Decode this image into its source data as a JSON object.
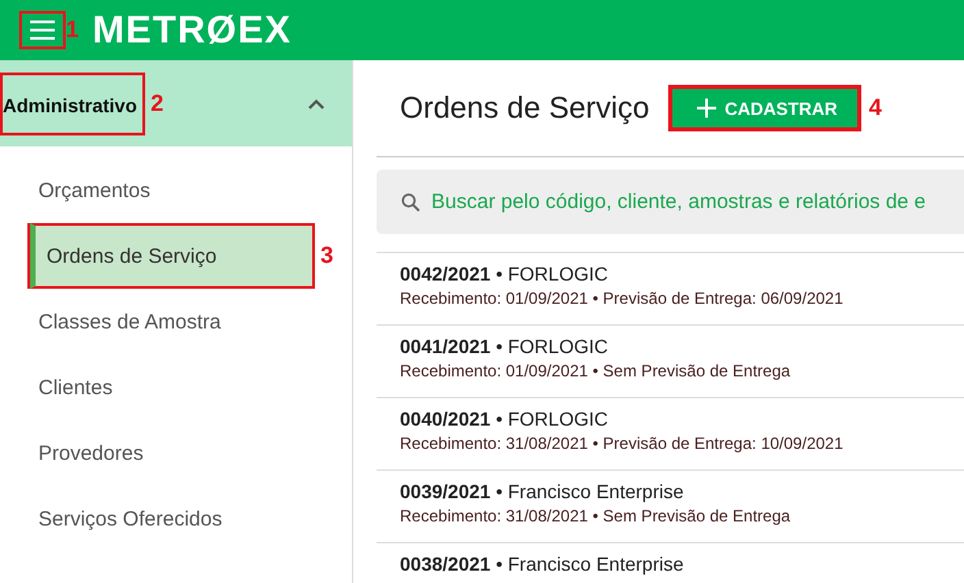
{
  "header": {
    "logo": "METRØEX",
    "menu_callout": "1"
  },
  "sidebar": {
    "section": {
      "label": "Administrativo",
      "expanded": true,
      "callout": "2"
    },
    "items": [
      {
        "label": "Orçamentos",
        "selected": false
      },
      {
        "label": "Ordens de Serviço",
        "selected": true,
        "callout": "3"
      },
      {
        "label": "Classes de Amostra",
        "selected": false
      },
      {
        "label": "Clientes",
        "selected": false
      },
      {
        "label": "Provedores",
        "selected": false
      },
      {
        "label": "Serviços Oferecidos",
        "selected": false
      }
    ]
  },
  "main": {
    "title": "Ordens de Serviço",
    "add_button": {
      "label": "CADASTRAR",
      "callout": "4"
    },
    "search": {
      "placeholder": "Buscar pelo código, cliente, amostras e relatórios de e"
    },
    "orders": [
      {
        "title": "**0042/2021** • FORLOGIC",
        "detail": "Recebimento: 01/09/2021 • Previsão de Entrega: 06/09/2021"
      },
      {
        "title": "**0041/2021** • FORLOGIC",
        "detail": "Recebimento: 01/09/2021 • Sem Previsão de Entrega"
      },
      {
        "title": "**0040/2021** • FORLOGIC",
        "detail": "Recebimento: 31/08/2021 • Previsão de Entrega: 10/09/2021"
      },
      {
        "title": "**0039/2021** • Francisco Enterprise",
        "detail": "Recebimento: 31/08/2021 • Sem Previsão de Entrega"
      },
      {
        "title": "**0038/2021** • Francisco Enterprise"
      }
    ]
  }
}
